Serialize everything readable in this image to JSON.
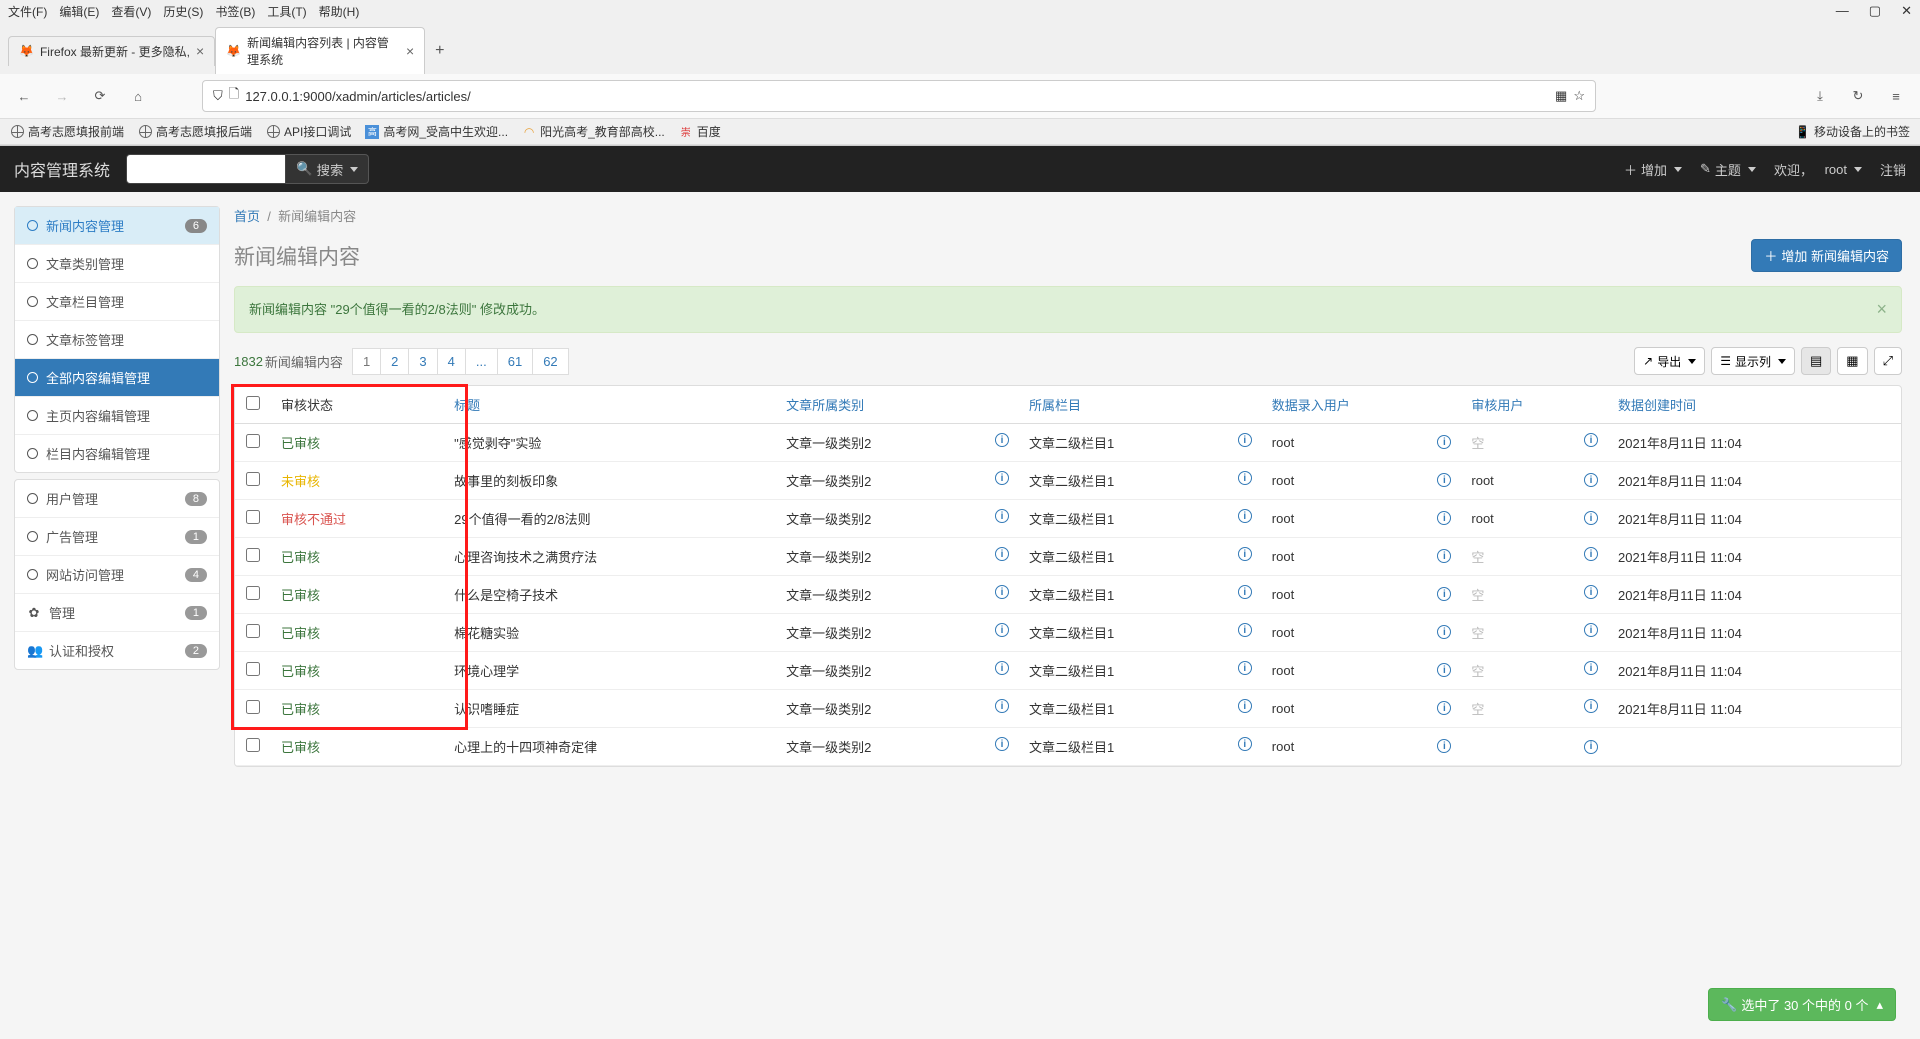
{
  "menubar": [
    "文件(F)",
    "编辑(E)",
    "查看(V)",
    "历史(S)",
    "书签(B)",
    "工具(T)",
    "帮助(H)"
  ],
  "tabs": [
    {
      "title": "Firefox 最新更新 - 更多隐私,",
      "active": false
    },
    {
      "title": "新闻编辑内容列表 | 内容管理系统",
      "active": true
    }
  ],
  "url": "127.0.0.1:9000/xadmin/articles/articles/",
  "bookmarks": [
    "高考志愿填报前端",
    "高考志愿填报后端",
    "API接口调试",
    "高考网_受高中生欢迎...",
    "阳光高考_教育部高校...",
    "百度"
  ],
  "mobile_bookmarks": "移动设备上的书签",
  "topbar": {
    "brand": "内容管理系统",
    "search_btn": "搜索",
    "add": "增加",
    "theme": "主题",
    "welcome": "欢迎，",
    "user": "root",
    "logout": "注销"
  },
  "sidebar": {
    "groups": [
      {
        "items": [
          {
            "label": "新闻内容管理",
            "badge": "6",
            "style": "header"
          },
          {
            "label": "文章类别管理"
          },
          {
            "label": "文章栏目管理"
          },
          {
            "label": "文章标签管理"
          },
          {
            "label": "全部内容编辑管理",
            "style": "active"
          },
          {
            "label": "主页内容编辑管理"
          },
          {
            "label": "栏目内容编辑管理"
          }
        ]
      },
      {
        "items": [
          {
            "label": "用户管理",
            "badge": "8",
            "icon": "circle"
          },
          {
            "label": "广告管理",
            "badge": "1",
            "icon": "circle"
          },
          {
            "label": "网站访问管理",
            "badge": "4",
            "icon": "circle"
          },
          {
            "label": "管理",
            "badge": "1",
            "icon": "gear"
          },
          {
            "label": "认证和授权",
            "badge": "2",
            "icon": "users"
          }
        ]
      }
    ]
  },
  "breadcrumb": {
    "home": "首页",
    "current": "新闻编辑内容"
  },
  "page_title": "新闻编辑内容",
  "add_button": "增加 新闻编辑内容",
  "alert": "新闻编辑内容 \"29个值得一看的2/8法则\" 修改成功。",
  "count": "1832",
  "count_label": "新闻编辑内容",
  "pages": [
    "1",
    "2",
    "3",
    "4",
    "...",
    "61",
    "62"
  ],
  "export_btn": "导出",
  "columns_btn": "显示列",
  "table": {
    "headers": [
      "审核状态",
      "标题",
      "文章所属类别",
      "所属栏目",
      "数据录入用户",
      "审核用户",
      "数据创建时间"
    ],
    "rows": [
      {
        "status": "已审核",
        "status_cls": "ok",
        "title": "\"感觉剥夺\"实验",
        "category": "文章一级类别2",
        "column": "文章二级栏目1",
        "creator": "root",
        "reviewer": "空",
        "reviewer_empty": true,
        "created": "2021年8月11日 11:04"
      },
      {
        "status": "未审核",
        "status_cls": "pending",
        "title": "故事里的刻板印象",
        "category": "文章一级类别2",
        "column": "文章二级栏目1",
        "creator": "root",
        "reviewer": "root",
        "reviewer_empty": false,
        "created": "2021年8月11日 11:04"
      },
      {
        "status": "审核不通过",
        "status_cls": "fail",
        "title": "29个值得一看的2/8法则",
        "category": "文章一级类别2",
        "column": "文章二级栏目1",
        "creator": "root",
        "reviewer": "root",
        "reviewer_empty": false,
        "created": "2021年8月11日 11:04"
      },
      {
        "status": "已审核",
        "status_cls": "ok",
        "title": "心理咨询技术之满贯疗法",
        "category": "文章一级类别2",
        "column": "文章二级栏目1",
        "creator": "root",
        "reviewer": "空",
        "reviewer_empty": true,
        "created": "2021年8月11日 11:04"
      },
      {
        "status": "已审核",
        "status_cls": "ok",
        "title": "什么是空椅子技术",
        "category": "文章一级类别2",
        "column": "文章二级栏目1",
        "creator": "root",
        "reviewer": "空",
        "reviewer_empty": true,
        "created": "2021年8月11日 11:04"
      },
      {
        "status": "已审核",
        "status_cls": "ok",
        "title": "棉花糖实验",
        "category": "文章一级类别2",
        "column": "文章二级栏目1",
        "creator": "root",
        "reviewer": "空",
        "reviewer_empty": true,
        "created": "2021年8月11日 11:04"
      },
      {
        "status": "已审核",
        "status_cls": "ok",
        "title": "环境心理学",
        "category": "文章一级类别2",
        "column": "文章二级栏目1",
        "creator": "root",
        "reviewer": "空",
        "reviewer_empty": true,
        "created": "2021年8月11日 11:04"
      },
      {
        "status": "已审核",
        "status_cls": "ok",
        "title": "认识嗜睡症",
        "category": "文章一级类别2",
        "column": "文章二级栏目1",
        "creator": "root",
        "reviewer": "空",
        "reviewer_empty": true,
        "created": "2021年8月11日 11:04"
      },
      {
        "status": "已审核",
        "status_cls": "ok",
        "title": "心理上的十四项神奇定律",
        "category": "文章一级类别2",
        "column": "文章二级栏目1",
        "creator": "root",
        "reviewer": "",
        "reviewer_empty": false,
        "created": ""
      }
    ]
  },
  "footer_action": "选中了 30 个中的 0 个"
}
